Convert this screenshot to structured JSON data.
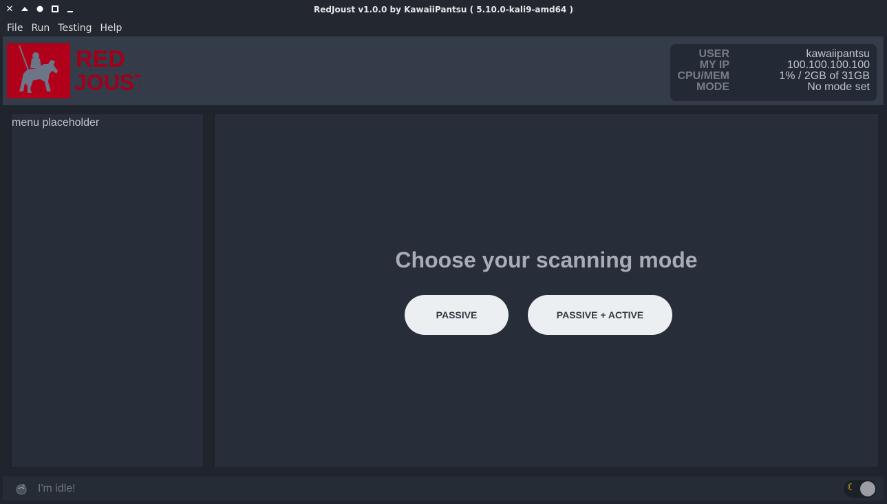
{
  "window": {
    "title": "RedJoust v1.0.0 by KawaiiPantsu ( 5.10.0-kali9-amd64 )",
    "controls": [
      "close-icon",
      "shade-icon",
      "stick-icon",
      "maximize-icon",
      "minimize-icon"
    ]
  },
  "menubar": {
    "items": [
      {
        "label": "File"
      },
      {
        "label": "Run"
      },
      {
        "label": "Testing"
      },
      {
        "label": "Help"
      }
    ]
  },
  "header": {
    "logo": {
      "line1": "RED",
      "line2": "JOUST"
    },
    "info": [
      {
        "key": "USER",
        "value": "kawaiipantsu"
      },
      {
        "key": "MY IP",
        "value": "100.100.100.100"
      },
      {
        "key": "CPU/MEM",
        "value": "1% / 2GB of 31GB"
      },
      {
        "key": "MODE",
        "value": "No mode set"
      }
    ]
  },
  "sidebar": {
    "placeholder": "menu placeholder"
  },
  "main": {
    "title": "Choose your scanning mode",
    "buttons": {
      "passive": "PASSIVE",
      "active": "PASSIVE + ACTIVE"
    }
  },
  "footer": {
    "status": "I'm idle!",
    "theme_toggle_icon": "moon-icon"
  },
  "colors": {
    "logo_red": "#b0001a",
    "background": "#1f242d",
    "panel": "#272d39",
    "header": "#343c4a"
  }
}
